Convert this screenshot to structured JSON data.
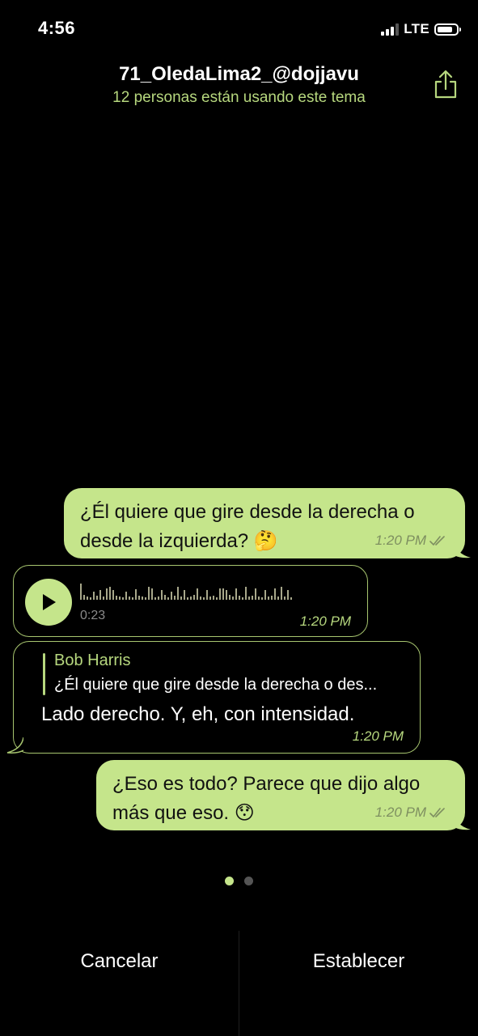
{
  "status_bar": {
    "time": "4:56",
    "network": "LTE"
  },
  "header": {
    "title": "71_OledaLima2_@dojjavu",
    "subtitle": "12 personas están usando este tema",
    "share_icon": "share-icon"
  },
  "messages": [
    {
      "type": "outgoing",
      "line1": "¿Él quiere que gire desde la derecha o",
      "line2": "desde la izquierda? 🤔",
      "time": "1:20 PM",
      "status": "read"
    },
    {
      "type": "incoming-voice",
      "duration": "0:23",
      "time": "1:20 PM"
    },
    {
      "type": "incoming-reply",
      "reply_to_name": "Bob Harris",
      "reply_to_text": "¿Él quiere que gire desde la derecha o des...",
      "text": "Lado derecho. Y, eh, con intensidad.",
      "time": "1:20 PM"
    },
    {
      "type": "outgoing",
      "line1": "¿Eso es todo? Parece que dijo algo",
      "line2": "más que eso. 😯",
      "time": "1:20 PM",
      "status": "read"
    }
  ],
  "pager": {
    "count": 2,
    "active": 0
  },
  "actions": {
    "cancel": "Cancelar",
    "set": "Establecer"
  },
  "colors": {
    "background": "#000000",
    "outgoing_bubble": "#c5e58b",
    "accent": "#b6d77e",
    "incoming_border": "#a7c56f"
  }
}
